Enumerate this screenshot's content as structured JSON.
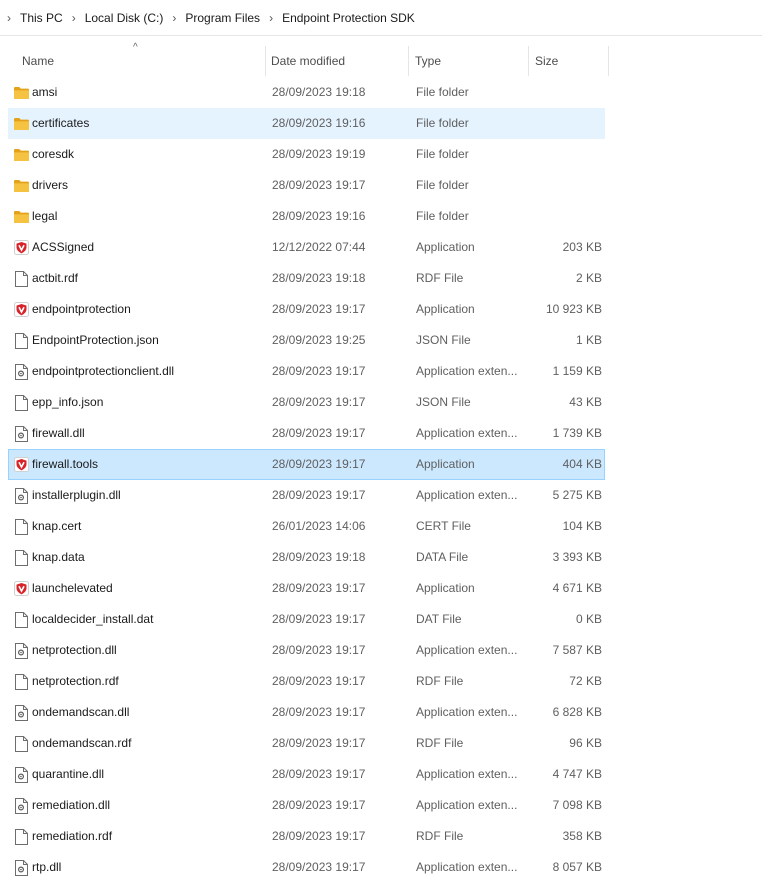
{
  "breadcrumb": [
    "This PC",
    "Local Disk (C:)",
    "Program Files",
    "Endpoint Protection SDK"
  ],
  "columns": {
    "name": "Name",
    "date": "Date modified",
    "type": "Type",
    "size": "Size"
  },
  "colors": {
    "selected_bg": "#cce8ff",
    "hover_bg": "#e5f3ff",
    "folder": "#f5c242",
    "shield": "#d8232a"
  },
  "files": [
    {
      "name": "amsi",
      "date": "28/09/2023 19:18",
      "type": "File folder",
      "size": "",
      "icon": "folder-icon"
    },
    {
      "name": "certificates",
      "date": "28/09/2023 19:16",
      "type": "File folder",
      "size": "",
      "icon": "folder-icon"
    },
    {
      "name": "coresdk",
      "date": "28/09/2023 19:19",
      "type": "File folder",
      "size": "",
      "icon": "folder-icon"
    },
    {
      "name": "drivers",
      "date": "28/09/2023 19:17",
      "type": "File folder",
      "size": "",
      "icon": "folder-icon"
    },
    {
      "name": "legal",
      "date": "28/09/2023 19:16",
      "type": "File folder",
      "size": "",
      "icon": "folder-icon"
    },
    {
      "name": "ACSSigned",
      "date": "12/12/2022 07:44",
      "type": "Application",
      "size": "203 KB",
      "icon": "shield-app-icon"
    },
    {
      "name": "actbit.rdf",
      "date": "28/09/2023 19:18",
      "type": "RDF File",
      "size": "2 KB",
      "icon": "file-icon"
    },
    {
      "name": "endpointprotection",
      "date": "28/09/2023 19:17",
      "type": "Application",
      "size": "10 923 KB",
      "icon": "shield-app-icon"
    },
    {
      "name": "EndpointProtection.json",
      "date": "28/09/2023 19:25",
      "type": "JSON File",
      "size": "1 KB",
      "icon": "file-icon"
    },
    {
      "name": "endpointprotectionclient.dll",
      "date": "28/09/2023 19:17",
      "type": "Application exten...",
      "size": "1 159 KB",
      "icon": "dll-icon"
    },
    {
      "name": "epp_info.json",
      "date": "28/09/2023 19:17",
      "type": "JSON File",
      "size": "43 KB",
      "icon": "file-icon"
    },
    {
      "name": "firewall.dll",
      "date": "28/09/2023 19:17",
      "type": "Application exten...",
      "size": "1 739 KB",
      "icon": "dll-icon"
    },
    {
      "name": "firewall.tools",
      "date": "28/09/2023 19:17",
      "type": "Application",
      "size": "404 KB",
      "icon": "shield-app-icon"
    },
    {
      "name": "installerplugin.dll",
      "date": "28/09/2023 19:17",
      "type": "Application exten...",
      "size": "5 275 KB",
      "icon": "dll-icon"
    },
    {
      "name": "knap.cert",
      "date": "26/01/2023 14:06",
      "type": "CERT File",
      "size": "104 KB",
      "icon": "file-icon"
    },
    {
      "name": "knap.data",
      "date": "28/09/2023 19:18",
      "type": "DATA File",
      "size": "3 393 KB",
      "icon": "file-icon"
    },
    {
      "name": "launchelevated",
      "date": "28/09/2023 19:17",
      "type": "Application",
      "size": "4 671 KB",
      "icon": "shield-app-icon"
    },
    {
      "name": "localdecider_install.dat",
      "date": "28/09/2023 19:17",
      "type": "DAT File",
      "size": "0 KB",
      "icon": "file-icon"
    },
    {
      "name": "netprotection.dll",
      "date": "28/09/2023 19:17",
      "type": "Application exten...",
      "size": "7 587 KB",
      "icon": "dll-icon"
    },
    {
      "name": "netprotection.rdf",
      "date": "28/09/2023 19:17",
      "type": "RDF File",
      "size": "72 KB",
      "icon": "file-icon"
    },
    {
      "name": "ondemandscan.dll",
      "date": "28/09/2023 19:17",
      "type": "Application exten...",
      "size": "6 828 KB",
      "icon": "dll-icon"
    },
    {
      "name": "ondemandscan.rdf",
      "date": "28/09/2023 19:17",
      "type": "RDF File",
      "size": "96 KB",
      "icon": "file-icon"
    },
    {
      "name": "quarantine.dll",
      "date": "28/09/2023 19:17",
      "type": "Application exten...",
      "size": "4 747 KB",
      "icon": "dll-icon"
    },
    {
      "name": "remediation.dll",
      "date": "28/09/2023 19:17",
      "type": "Application exten...",
      "size": "7 098 KB",
      "icon": "dll-icon"
    },
    {
      "name": "remediation.rdf",
      "date": "28/09/2023 19:17",
      "type": "RDF File",
      "size": "358 KB",
      "icon": "file-icon"
    },
    {
      "name": "rtp.dll",
      "date": "28/09/2023 19:17",
      "type": "Application exten...",
      "size": "8 057 KB",
      "icon": "dll-icon"
    }
  ],
  "hover_index": 1,
  "selected_index": 12
}
